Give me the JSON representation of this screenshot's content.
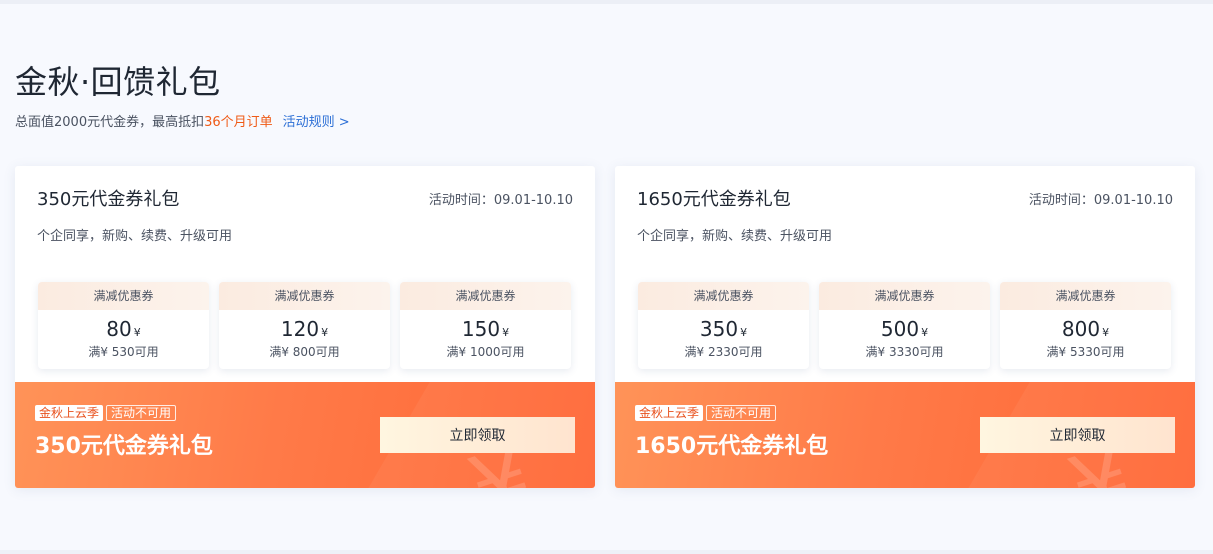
{
  "header": {
    "title": "金秋·回馈礼包",
    "subtitle_prefix": "总面值2000元代金券，最高抵扣",
    "subtitle_highlight": "36个月订单",
    "rules_link": "活动规则 >"
  },
  "colors": {
    "accent": "#ef5b17",
    "link": "#2c6fd6",
    "banner_start": "#ff9358",
    "banner_end": "#ff6735"
  },
  "packages": [
    {
      "title": "350元代金券礼包",
      "time": "活动时间：09.01-10.10",
      "desc": "个企同享，新购、续费、升级可用",
      "coupons": [
        {
          "head": "满减优惠券",
          "amount": "80",
          "currency": "¥",
          "condition": "满¥ 530可用"
        },
        {
          "head": "满减优惠券",
          "amount": "120",
          "currency": "¥",
          "condition": "满¥ 800可用"
        },
        {
          "head": "满减优惠券",
          "amount": "150",
          "currency": "¥",
          "condition": "满¥ 1000可用"
        }
      ],
      "tag_season": "金秋上云季",
      "tag_status": "活动不可用",
      "banner_title": "350元代金券礼包",
      "button_label": "立即领取"
    },
    {
      "title": "1650元代金券礼包",
      "time": "活动时间：09.01-10.10",
      "desc": "个企同享，新购、续费、升级可用",
      "coupons": [
        {
          "head": "满减优惠券",
          "amount": "350",
          "currency": "¥",
          "condition": "满¥ 2330可用"
        },
        {
          "head": "满减优惠券",
          "amount": "500",
          "currency": "¥",
          "condition": "满¥ 3330可用"
        },
        {
          "head": "满减优惠券",
          "amount": "800",
          "currency": "¥",
          "condition": "满¥ 5330可用"
        }
      ],
      "tag_season": "金秋上云季",
      "tag_status": "活动不可用",
      "banner_title": "1650元代金券礼包",
      "button_label": "立即领取"
    }
  ]
}
